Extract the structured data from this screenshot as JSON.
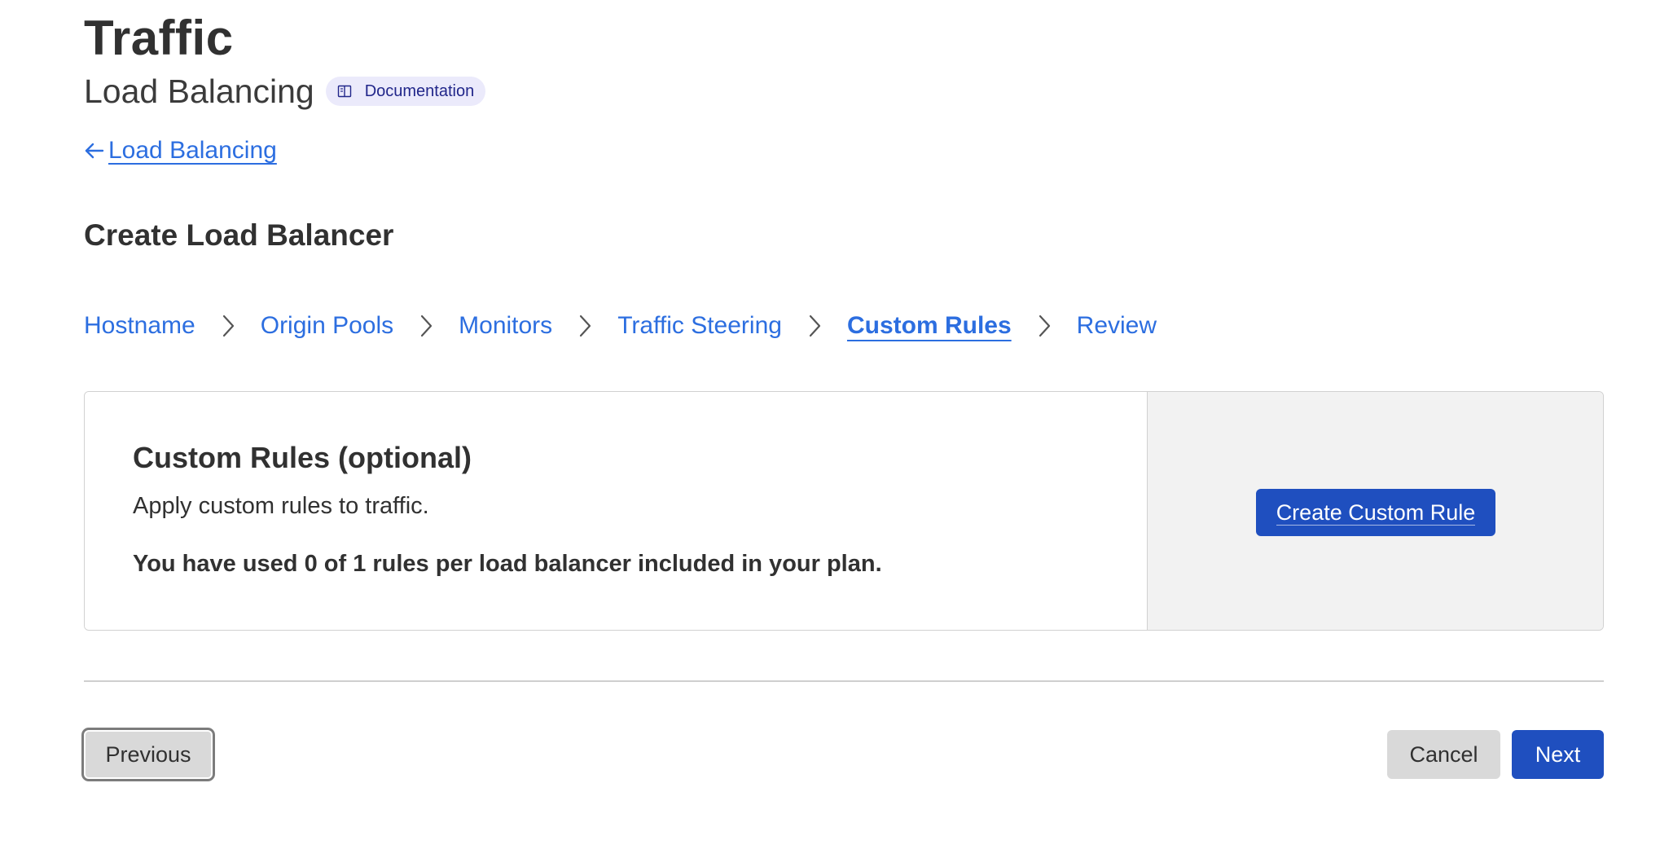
{
  "header": {
    "title": "Traffic",
    "subtitle": "Load Balancing",
    "doc_badge": "Documentation",
    "doc_icon": "book-icon"
  },
  "back_link": {
    "label": "Load Balancing",
    "icon": "arrow-left-icon"
  },
  "section_title": "Create Load Balancer",
  "steps": [
    {
      "label": "Hostname",
      "active": false
    },
    {
      "label": "Origin Pools",
      "active": false
    },
    {
      "label": "Monitors",
      "active": false
    },
    {
      "label": "Traffic Steering",
      "active": false
    },
    {
      "label": "Custom Rules",
      "active": true
    },
    {
      "label": "Review",
      "active": false
    }
  ],
  "card": {
    "heading": "Custom Rules (optional)",
    "description": "Apply custom rules to traffic.",
    "usage": "You have used 0 of 1 rules per load balancer included in your plan.",
    "create_button": "Create Custom Rule"
  },
  "footer": {
    "previous": "Previous",
    "cancel": "Cancel",
    "next": "Next"
  },
  "colors": {
    "link": "#2c6ee0",
    "primary_button": "#1f4fbf",
    "secondary_button": "#d9d9d9",
    "badge_bg": "#ebeafb",
    "badge_text": "#21268a"
  }
}
